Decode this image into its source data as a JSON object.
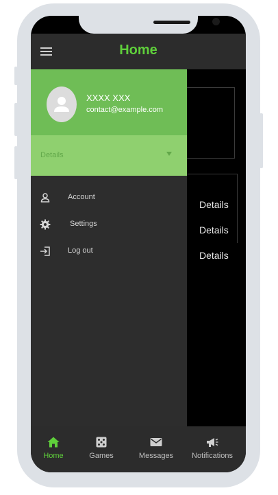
{
  "appbar": {
    "title": "Home"
  },
  "content": {
    "details": [
      "Details",
      "Details",
      "Details"
    ]
  },
  "drawer": {
    "user_name": "XXXX XXX",
    "user_email": "contact@example.com",
    "details_label": "Details",
    "menu": [
      {
        "label": "Account",
        "icon": "person-icon"
      },
      {
        "label": "Settings",
        "icon": "gear-icon"
      },
      {
        "label": "Log out",
        "icon": "logout-icon"
      }
    ]
  },
  "bottom_nav": {
    "active": "Home",
    "items": [
      {
        "label": "Home",
        "icon": "home-icon"
      },
      {
        "label": "Games",
        "icon": "dice-icon"
      },
      {
        "label": "Messages",
        "icon": "envelope-icon"
      },
      {
        "label": "Notifications",
        "icon": "megaphone-icon"
      }
    ]
  },
  "colors": {
    "accent": "#5fcf3b",
    "drawer_header": "#6fbd56",
    "details_row": "#8fd06f",
    "bar": "#2c2c2c",
    "frame": "#dde1e6"
  }
}
